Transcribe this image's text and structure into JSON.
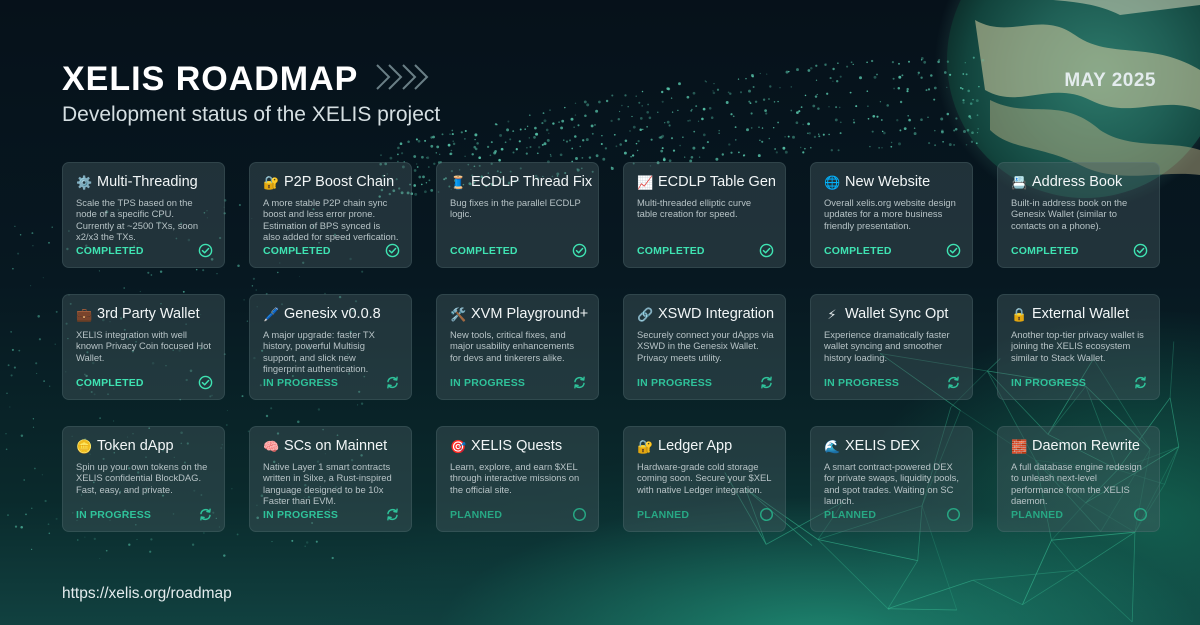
{
  "header": {
    "title": "XELIS ROADMAP",
    "subtitle": "Development status of the XELIS project",
    "date": "MAY 2025"
  },
  "footer": {
    "url": "https://xelis.org/roadmap"
  },
  "status_colors": {
    "completed": "#3fe3b2",
    "in_progress": "#2fc29a",
    "planned": "#27a884"
  },
  "cards": [
    {
      "icon": "gear-icon",
      "glyph": "⚙️",
      "title": "Multi-Threading",
      "desc": "Scale the TPS based on the node of a specific CPU. Currently at ~2500 TXs, soon x2/x3 the TXs.",
      "status": "COMPLETED",
      "status_key": "completed"
    },
    {
      "icon": "lock-key-icon",
      "glyph": "🔐",
      "title": "P2P Boost Chain",
      "desc": "A more stable P2P chain sync boost and less error prone. Estimation of BPS synced is also added for speed verfication.",
      "status": "COMPLETED",
      "status_key": "completed"
    },
    {
      "icon": "thread-spool-icon",
      "glyph": "🧵",
      "title": "ECDLP Thread Fix",
      "desc": "Bug fixes in the parallel ECDLP logic.",
      "status": "COMPLETED",
      "status_key": "completed"
    },
    {
      "icon": "chart-up-icon",
      "glyph": "📈",
      "title": "ECDLP Table Gen",
      "desc": "Multi-threaded elliptic curve table creation for speed.",
      "status": "COMPLETED",
      "status_key": "completed"
    },
    {
      "icon": "globe-icon",
      "glyph": "🌐",
      "title": "New Website",
      "desc": "Overall xelis.org website design updates for a more business friendly presentation.",
      "status": "COMPLETED",
      "status_key": "completed"
    },
    {
      "icon": "address-book-icon",
      "glyph": "📇",
      "title": "Address Book",
      "desc": "Built-in address book on the Genesix Wallet (similar to contacts on a phone).",
      "status": "COMPLETED",
      "status_key": "completed"
    },
    {
      "icon": "briefcase-icon",
      "glyph": "💼",
      "title": "3rd Party Wallet",
      "desc": "XELIS integration with well known Privacy Coin focused Hot Wallet.",
      "status": "COMPLETED",
      "status_key": "completed"
    },
    {
      "icon": "pencil-icon",
      "glyph": "🖊️",
      "title": "Genesix v0.0.8",
      "desc": "A major upgrade: faster TX history, powerful Multisig support, and slick new fingerprint authentication.",
      "status": "IN PROGRESS",
      "status_key": "in_progress"
    },
    {
      "icon": "hammer-wrench-icon",
      "glyph": "🛠️",
      "title": "XVM Playground+",
      "desc": "New tools, critical fixes, and major usability enhancements for devs and tinkerers alike.",
      "status": "IN PROGRESS",
      "status_key": "in_progress"
    },
    {
      "icon": "link-icon",
      "glyph": "🔗",
      "title": "XSWD Integration",
      "desc": "Securely connect your dApps via XSWD in the Genesix Wallet. Privacy meets utility.",
      "status": "IN PROGRESS",
      "status_key": "in_progress"
    },
    {
      "icon": "lightning-icon",
      "glyph": "⚡",
      "title": "Wallet Sync Opt",
      "desc": "Experience dramatically faster wallet syncing and smoother history loading.",
      "status": "IN PROGRESS",
      "status_key": "in_progress"
    },
    {
      "icon": "lock-icon",
      "glyph": "🔒",
      "title": "External Wallet",
      "desc": "Another top-tier privacy wallet is joining the XELIS ecosystem similar to Stack Wallet.",
      "status": "IN PROGRESS",
      "status_key": "in_progress"
    },
    {
      "icon": "coin-icon",
      "glyph": "🪙",
      "title": "Token dApp",
      "desc": "Spin up your own tokens on the XELIS confidential BlockDAG. Fast, easy, and private.",
      "status": "IN PROGRESS",
      "status_key": "in_progress"
    },
    {
      "icon": "brain-icon",
      "glyph": "🧠",
      "title": "SCs on Mainnet",
      "desc": "Native Layer 1 smart contracts written in Silxe, a Rust-inspired language designed to be 10x Faster than EVM.",
      "status": "IN PROGRESS",
      "status_key": "in_progress"
    },
    {
      "icon": "target-icon",
      "glyph": "🎯",
      "title": "XELIS Quests",
      "desc": "Learn, explore, and earn $XEL through interactive missions on the official site.",
      "status": "PLANNED",
      "status_key": "planned"
    },
    {
      "icon": "lock-key-icon",
      "glyph": "🔐",
      "title": "Ledger App",
      "desc": "Hardware-grade cold storage coming soon. Secure your $XEL with native Ledger integration.",
      "status": "PLANNED",
      "status_key": "planned"
    },
    {
      "icon": "wave-icon",
      "glyph": "🌊",
      "title": "XELIS DEX",
      "desc": "A smart contract-powered DEX for private swaps, liquidity pools, and spot trades. Waiting on SC launch.",
      "status": "PLANNED",
      "status_key": "planned"
    },
    {
      "icon": "red-block-icon",
      "glyph": "🧱",
      "title": "Daemon Rewrite",
      "desc": "A full database engine redesign to unleash next-level performance from the XELIS daemon.",
      "status": "PLANNED",
      "status_key": "planned"
    }
  ]
}
